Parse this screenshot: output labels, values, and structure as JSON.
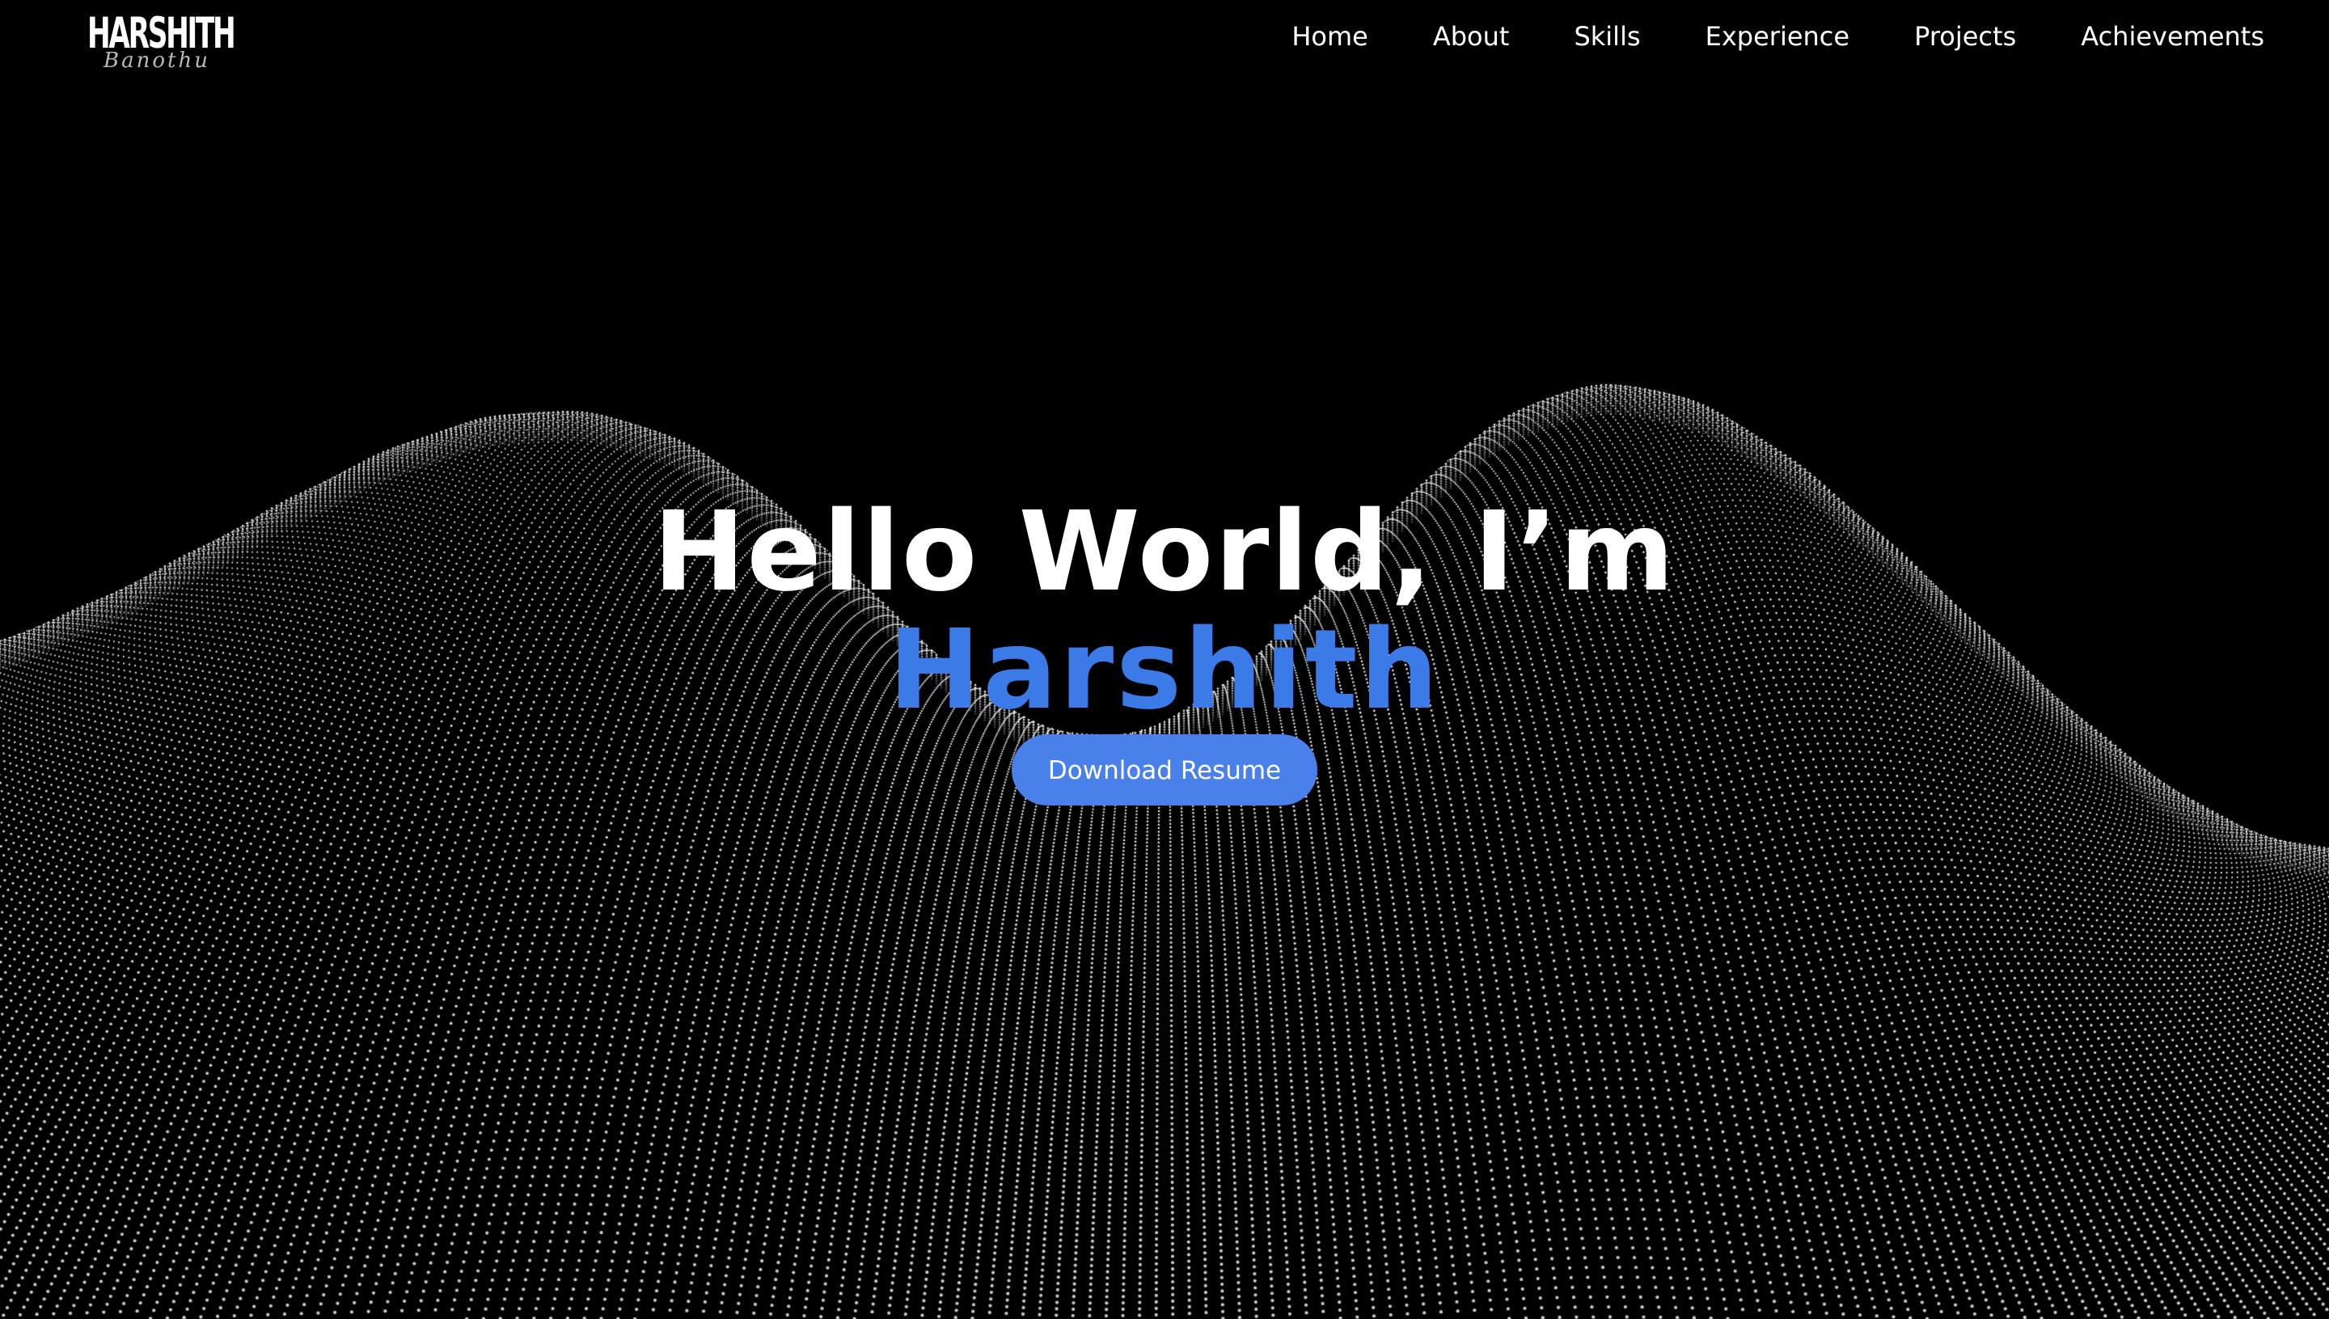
{
  "header": {
    "logo_main": "HARSHITH",
    "logo_script": "Banothu",
    "nav": [
      {
        "label": "Home"
      },
      {
        "label": "About"
      },
      {
        "label": "Skills"
      },
      {
        "label": "Experience"
      },
      {
        "label": "Projects"
      },
      {
        "label": "Achievements"
      }
    ]
  },
  "hero": {
    "greeting": "Hello World, I’m",
    "name": "Harshith",
    "button_label": "Download Resume"
  },
  "colors": {
    "background": "#000000",
    "accent": "#3b7be8",
    "button": "#4a80ea",
    "particles": "#ffffff"
  },
  "background": {
    "type": "particle-wave",
    "icon": "dot-wave-background"
  }
}
